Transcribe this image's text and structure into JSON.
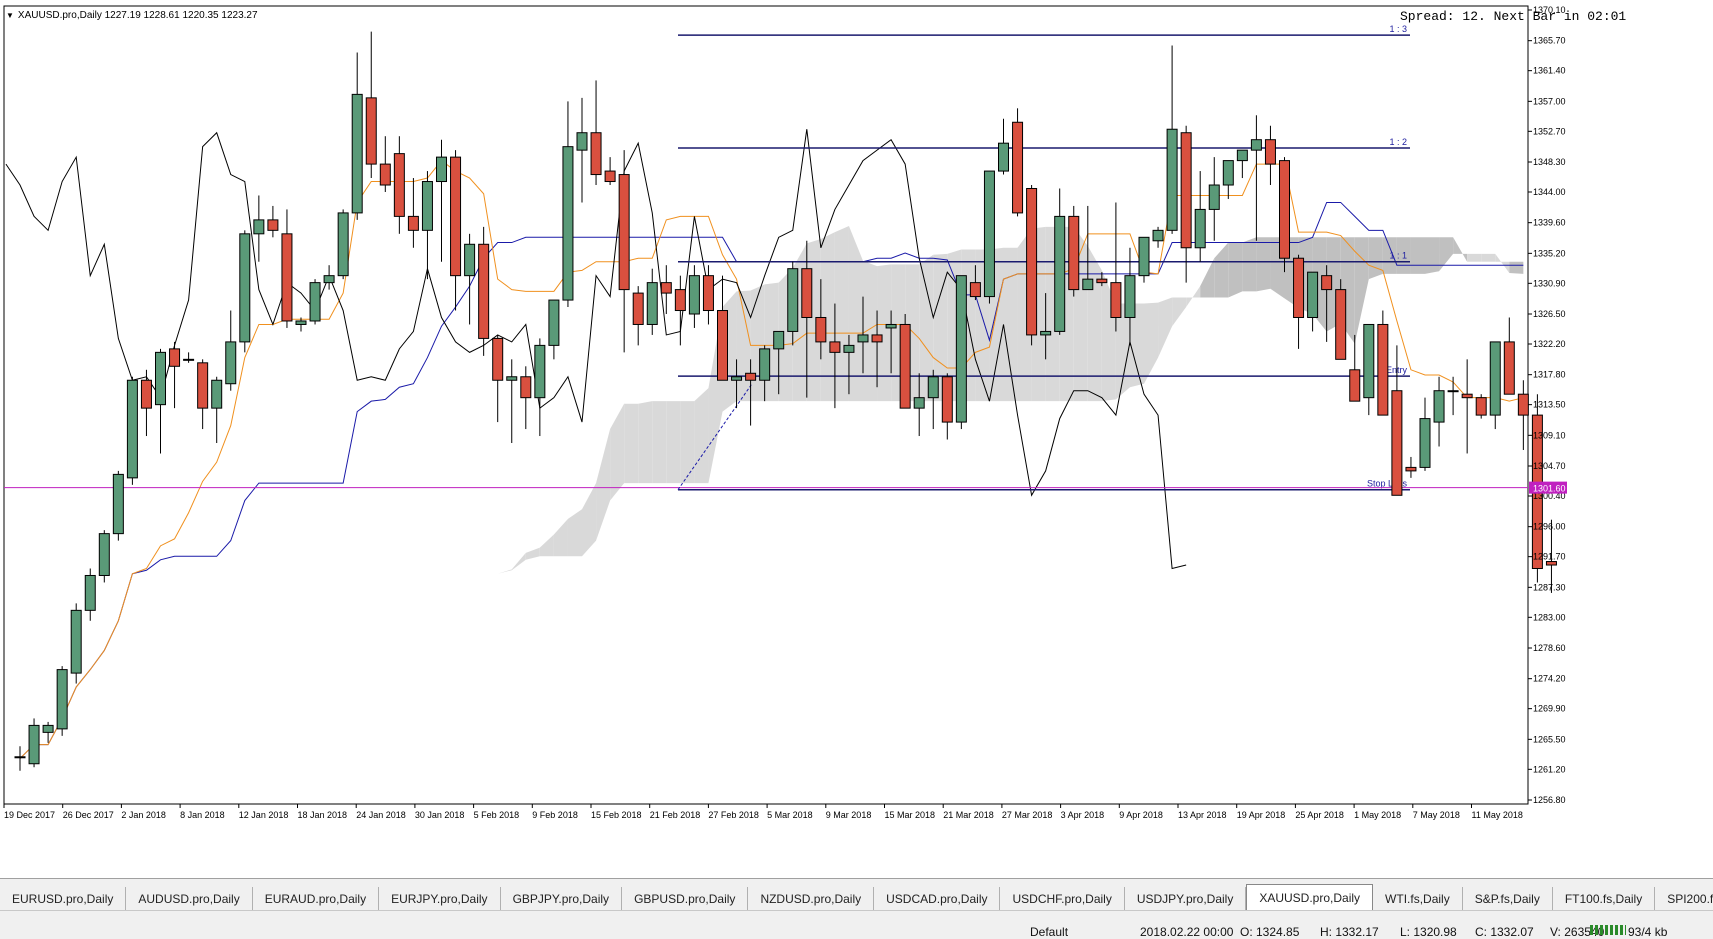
{
  "window": {
    "symbol_line": "XAUUSD.pro,Daily  1227.19 1228.61 1220.35 1223.27",
    "spread_text": "Spread: 12. Next Bar in 02:01"
  },
  "price_axis": {
    "labels": [
      "1370.10",
      "1365.70",
      "1361.40",
      "1357.00",
      "1352.70",
      "1348.30",
      "1344.00",
      "1339.60",
      "1335.20",
      "1330.90",
      "1326.50",
      "1322.20",
      "1317.80",
      "1313.50",
      "1309.10",
      "1304.70",
      "1300.40",
      "1296.00",
      "1291.70",
      "1287.30",
      "1283.00",
      "1278.60",
      "1274.20",
      "1269.90",
      "1265.50",
      "1261.20",
      "1256.80"
    ],
    "current_price_label": "1301.60"
  },
  "time_axis": {
    "labels": [
      "19 Dec 2017",
      "26 Dec 2017",
      "2 Jan 2018",
      "8 Jan 2018",
      "12 Jan 2018",
      "18 Jan 2018",
      "24 Jan 2018",
      "30 Jan 2018",
      "5 Feb 2018",
      "9 Feb 2018",
      "15 Feb 2018",
      "21 Feb 2018",
      "27 Feb 2018",
      "5 Mar 2018",
      "9 Mar 2018",
      "15 Mar 2018",
      "21 Mar 2018",
      "27 Mar 2018",
      "3 Apr 2018",
      "9 Apr 2018",
      "13 Apr 2018",
      "19 Apr 2018",
      "25 Apr 2018",
      "1 May 2018",
      "7 May 2018",
      "11 May 2018"
    ]
  },
  "levels": [
    {
      "label": "1 : 3",
      "price": 1366.5
    },
    {
      "label": "1 : 2",
      "price": 1350.3
    },
    {
      "label": "1 : 1",
      "price": 1334.0
    },
    {
      "label": "Entry",
      "price": 1317.6
    },
    {
      "label": "Stop Loss",
      "price": 1301.3
    }
  ],
  "colors": {
    "bull": "#5a9a78",
    "bear": "#d9503f",
    "tenkan": "#f0901e",
    "kijun": "#1a1aa8",
    "chikou": "#000000",
    "cloud_bull": "#d9d9d9",
    "cloud_bear": "#c0c0c0",
    "level_line": "#1a1a6e",
    "stop_line": "#c020c0"
  },
  "tabs": [
    "EURUSD.pro,Daily",
    "AUDUSD.pro,Daily",
    "EURAUD.pro,Daily",
    "EURJPY.pro,Daily",
    "GBPJPY.pro,Daily",
    "GBPUSD.pro,Daily",
    "NZDUSD.pro,Daily",
    "USDCAD.pro,Daily",
    "USDCHF.pro,Daily",
    "USDJPY.pro,Daily",
    "XAUUSD.pro,Daily",
    "WTI.fs,Daily",
    "S&P.fs,Daily",
    "FT100.fs,Daily",
    "SPI200.fs,Daily"
  ],
  "active_tab": "XAUUSD.pro,Daily",
  "status_bar": {
    "profile": "Default",
    "datetime": "2018.02.22 00:00",
    "open": "O: 1324.85",
    "high": "H: 1332.17",
    "low": "L: 1320.98",
    "close": "C: 1332.07",
    "volume": "V: 263540",
    "traffic": "93/4 kb"
  },
  "chart_data": {
    "type": "candlestick",
    "symbol": "XAUUSD.pro",
    "timeframe": "Daily",
    "ylim": [
      1256.8,
      1370.1
    ],
    "candles": [
      [
        1263.0,
        1264.5,
        1261.0,
        1263.0
      ],
      [
        1262.0,
        1268.5,
        1261.5,
        1267.5
      ],
      [
        1266.5,
        1268.0,
        1265.0,
        1267.5
      ],
      [
        1267.0,
        1276.0,
        1266.0,
        1275.5
      ],
      [
        1275.0,
        1285.0,
        1273.5,
        1284.0
      ],
      [
        1284.0,
        1290.0,
        1282.5,
        1289.0
      ],
      [
        1289.0,
        1295.5,
        1288.0,
        1295.0
      ],
      [
        1295.0,
        1304.0,
        1294.0,
        1303.5
      ],
      [
        1303.0,
        1317.5,
        1302.0,
        1317.0
      ],
      [
        1317.0,
        1318.5,
        1309.0,
        1313.0
      ],
      [
        1313.5,
        1321.5,
        1306.5,
        1321.0
      ],
      [
        1321.5,
        1322.5,
        1313.0,
        1319.0
      ],
      [
        1320.0,
        1321.0,
        1319.5,
        1320.0
      ],
      [
        1319.5,
        1320.0,
        1310.0,
        1313.0
      ],
      [
        1313.0,
        1317.5,
        1308.0,
        1317.0
      ],
      [
        1316.5,
        1327.0,
        1315.5,
        1322.5
      ],
      [
        1322.5,
        1338.5,
        1321.0,
        1338.0
      ],
      [
        1338.0,
        1343.5,
        1334.0,
        1340.0
      ],
      [
        1340.0,
        1342.0,
        1337.5,
        1338.5
      ],
      [
        1338.0,
        1341.5,
        1324.5,
        1325.5
      ],
      [
        1325.0,
        1326.0,
        1324.0,
        1325.5
      ],
      [
        1325.5,
        1331.5,
        1325.0,
        1331.0
      ],
      [
        1331.0,
        1333.5,
        1330.0,
        1332.0
      ],
      [
        1332.0,
        1341.5,
        1331.5,
        1341.0
      ],
      [
        1341.0,
        1364.0,
        1340.0,
        1358.0
      ],
      [
        1357.5,
        1367.0,
        1346.0,
        1348.0
      ],
      [
        1348.0,
        1352.0,
        1344.0,
        1345.0
      ],
      [
        1349.5,
        1352.0,
        1338.0,
        1340.5
      ],
      [
        1340.5,
        1346.0,
        1336.0,
        1338.5
      ],
      [
        1338.5,
        1347.0,
        1331.5,
        1345.5
      ],
      [
        1345.5,
        1351.5,
        1334.0,
        1349.0
      ],
      [
        1349.0,
        1350.0,
        1327.0,
        1332.0
      ],
      [
        1332.0,
        1338.0,
        1325.0,
        1336.5
      ],
      [
        1336.5,
        1339.0,
        1320.5,
        1323.0
      ],
      [
        1323.0,
        1323.5,
        1311.0,
        1317.0
      ],
      [
        1317.0,
        1320.0,
        1308.0,
        1317.5
      ],
      [
        1317.5,
        1319.0,
        1310.0,
        1314.5
      ],
      [
        1314.5,
        1323.0,
        1309.0,
        1322.0
      ],
      [
        1322.0,
        1328.0,
        1320.0,
        1328.5
      ],
      [
        1328.5,
        1357.0,
        1327.5,
        1350.5
      ],
      [
        1350.0,
        1357.5,
        1342.5,
        1352.5
      ],
      [
        1352.5,
        1360.0,
        1345.0,
        1346.5
      ],
      [
        1347.0,
        1349.0,
        1345.0,
        1345.5
      ],
      [
        1346.5,
        1350.0,
        1321.0,
        1330.0
      ],
      [
        1329.5,
        1330.5,
        1322.0,
        1325.0
      ],
      [
        1325.0,
        1333.0,
        1323.5,
        1331.0
      ],
      [
        1331.0,
        1333.5,
        1326.5,
        1329.5
      ],
      [
        1330.0,
        1332.0,
        1322.0,
        1327.0
      ],
      [
        1326.5,
        1333.5,
        1324.5,
        1332.0
      ],
      [
        1332.0,
        1333.5,
        1325.0,
        1327.0
      ],
      [
        1327.0,
        1332.0,
        1320.0,
        1317.0
      ],
      [
        1317.0,
        1320.0,
        1313.0,
        1317.5
      ],
      [
        1318.0,
        1320.0,
        1310.5,
        1317.0
      ],
      [
        1317.0,
        1322.0,
        1314.0,
        1321.5
      ],
      [
        1321.5,
        1323.5,
        1315.0,
        1324.0
      ],
      [
        1324.0,
        1334.0,
        1322.0,
        1333.0
      ],
      [
        1333.0,
        1337.0,
        1314.5,
        1326.0
      ],
      [
        1326.0,
        1331.5,
        1320.0,
        1322.5
      ],
      [
        1322.5,
        1328.0,
        1313.0,
        1321.0
      ],
      [
        1321.0,
        1323.5,
        1315.0,
        1322.0
      ],
      [
        1322.5,
        1329.0,
        1318.0,
        1323.5
      ],
      [
        1323.5,
        1327.0,
        1316.0,
        1322.5
      ],
      [
        1324.5,
        1327.0,
        1318.0,
        1325.0
      ],
      [
        1325.0,
        1326.5,
        1315.0,
        1313.0
      ],
      [
        1313.0,
        1318.0,
        1309.0,
        1314.5
      ],
      [
        1314.5,
        1318.5,
        1310.0,
        1317.5
      ],
      [
        1317.5,
        1318.0,
        1308.5,
        1311.0
      ],
      [
        1311.0,
        1324.0,
        1310.0,
        1332.0
      ],
      [
        1331.0,
        1333.5,
        1328.5,
        1329.0
      ],
      [
        1329.0,
        1335.0,
        1328.0,
        1347.0
      ],
      [
        1347.0,
        1354.5,
        1346.5,
        1351.0
      ],
      [
        1354.0,
        1356.0,
        1340.5,
        1341.0
      ],
      [
        1344.5,
        1345.0,
        1322.0,
        1323.5
      ],
      [
        1323.5,
        1329.5,
        1320.0,
        1324.0
      ],
      [
        1324.0,
        1344.5,
        1323.5,
        1340.5
      ],
      [
        1340.5,
        1342.0,
        1329.0,
        1330.0
      ],
      [
        1330.0,
        1342.0,
        1330.0,
        1331.5
      ],
      [
        1331.5,
        1332.5,
        1330.5,
        1331.0
      ],
      [
        1331.0,
        1342.5,
        1324.0,
        1326.0
      ],
      [
        1326.0,
        1336.0,
        1322.0,
        1332.0
      ],
      [
        1332.0,
        1337.5,
        1331.0,
        1337.5
      ],
      [
        1337.0,
        1339.0,
        1336.0,
        1338.5
      ],
      [
        1338.5,
        1365.0,
        1338.0,
        1353.0
      ],
      [
        1352.5,
        1353.5,
        1331.0,
        1336.0
      ],
      [
        1336.0,
        1347.0,
        1334.0,
        1341.5
      ],
      [
        1341.5,
        1349.0,
        1337.0,
        1345.0
      ],
      [
        1345.0,
        1348.5,
        1343.0,
        1348.5
      ],
      [
        1348.5,
        1350.0,
        1346.0,
        1350.0
      ],
      [
        1350.0,
        1355.0,
        1337.0,
        1351.5
      ],
      [
        1351.5,
        1353.5,
        1345.0,
        1348.0
      ],
      [
        1348.5,
        1349.0,
        1332.5,
        1334.5
      ],
      [
        1334.5,
        1335.0,
        1321.5,
        1326.0
      ],
      [
        1326.0,
        1331.0,
        1324.0,
        1332.5
      ],
      [
        1332.0,
        1333.5,
        1322.5,
        1330.0
      ],
      [
        1330.0,
        1331.5,
        1320.5,
        1320.0
      ],
      [
        1318.5,
        1323.5,
        1316.0,
        1314.0
      ],
      [
        1314.5,
        1323.0,
        1312.0,
        1325.0
      ],
      [
        1325.0,
        1327.0,
        1315.0,
        1312.0
      ],
      [
        1315.5,
        1322.0,
        1302.0,
        1300.5
      ],
      [
        1304.5,
        1306.0,
        1303.0,
        1304.0
      ],
      [
        1304.5,
        1314.5,
        1304.0,
        1311.5
      ],
      [
        1311.0,
        1317.5,
        1307.5,
        1315.5
      ],
      [
        1315.5,
        1317.5,
        1312.0,
        1315.5
      ],
      [
        1315.0,
        1320.0,
        1306.5,
        1314.5
      ],
      [
        1314.5,
        1315.0,
        1311.5,
        1312.0
      ],
      [
        1312.0,
        1318.0,
        1310.0,
        1322.5
      ],
      [
        1322.5,
        1326.0,
        1315.0,
        1315.0
      ],
      [
        1315.0,
        1317.0,
        1307.0,
        1312.0
      ],
      [
        1312.0,
        1315.0,
        1288.0,
        1290.0
      ],
      [
        1291.0,
        1297.0,
        1286.5,
        1290.5
      ]
    ]
  }
}
